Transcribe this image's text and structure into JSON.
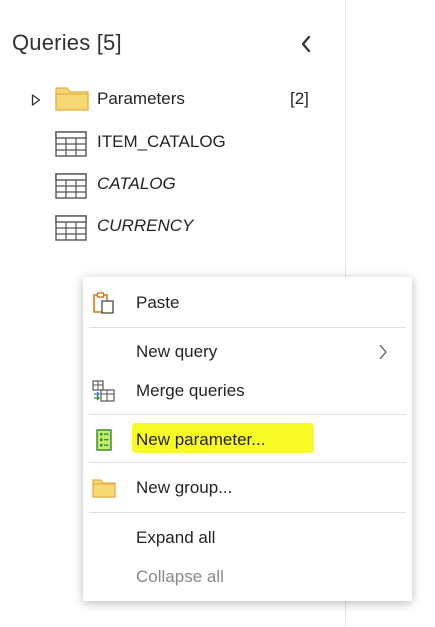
{
  "pane": {
    "title": "Queries [5]",
    "collapse_icon": "chevron-left-icon"
  },
  "tree": {
    "folder": {
      "label": "Parameters",
      "count": "[2]",
      "icon": "folder-icon",
      "expanded": false
    },
    "items": [
      {
        "label": "ITEM_CATALOG",
        "italic": false,
        "icon": "table-icon"
      },
      {
        "label": "CATALOG",
        "italic": true,
        "icon": "table-icon"
      },
      {
        "label": "CURRENCY",
        "italic": true,
        "icon": "table-icon"
      }
    ]
  },
  "context_menu": {
    "paste": {
      "label": "Paste",
      "icon": "clipboard-paste-icon"
    },
    "new_query": {
      "label": "New query",
      "has_submenu": true
    },
    "merge_queries": {
      "label": "Merge queries",
      "icon": "merge-queries-icon"
    },
    "new_parameter": {
      "label": "New parameter...",
      "icon": "parameter-icon",
      "highlight_color": "#f6fb1a"
    },
    "new_group": {
      "label": "New group...",
      "icon": "folder-icon"
    },
    "expand_all": {
      "label": "Expand all"
    },
    "collapse_all": {
      "label": "Collapse all",
      "disabled": true
    }
  },
  "colors": {
    "folder_fill": "#f8d775",
    "folder_edge": "#e0b040",
    "accent_orange": "#d47500",
    "parameter_green": "#2e8b2e",
    "highlight": "#f6fb1a"
  }
}
